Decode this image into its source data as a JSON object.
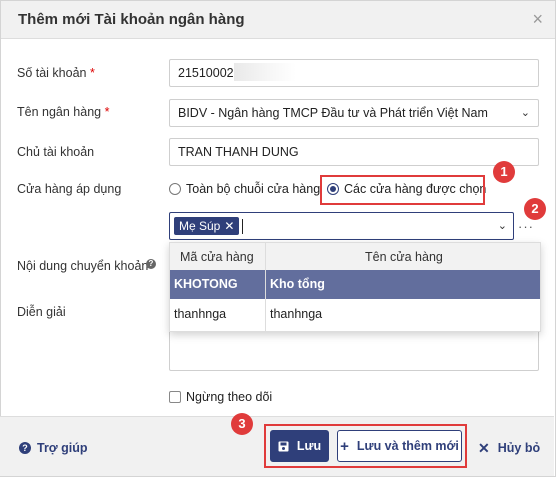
{
  "dialog": {
    "title": "Thêm mới Tài khoản ngân hàng",
    "close": "×"
  },
  "form": {
    "account_number_label": "Số tài khoản",
    "account_number_value": "21510002",
    "bank_name_label": "Tên ngân hàng",
    "bank_name_value": "BIDV - Ngân hàng TMCP Đầu tư và Phát triển Việt Nam",
    "owner_label": "Chủ tài khoản",
    "owner_value": "TRAN THANH DUNG",
    "store_scope_label": "Cửa hàng áp dụng",
    "scope_option_all": "Toàn bộ chuỗi cửa hàng",
    "scope_option_selected": "Các cửa hàng được chọn",
    "selected_tag": "Mẹ Súp",
    "transfer_content_label": "Nội dung chuyển khoản",
    "description_label": "Diễn giải",
    "stop_tracking_label": "Ngừng theo dõi",
    "required_mark": "*"
  },
  "dropdown": {
    "col_code": "Mã cửa hàng",
    "col_name": "Tên cửa hàng",
    "rows": [
      {
        "code": "KHOTONG",
        "name": "Kho tổng"
      },
      {
        "code": "thanhnga",
        "name": "thanhnga"
      }
    ]
  },
  "annotations": {
    "step1": "1",
    "step2": "2",
    "step3": "3",
    "accent": "#e03b3b"
  },
  "footer": {
    "help": "Trợ giúp",
    "save": "Lưu",
    "save_new": "Lưu và thêm mới",
    "cancel": "Hủy bỏ"
  },
  "colors": {
    "primary": "#2f3f7a",
    "selected_row": "#626e9d"
  }
}
